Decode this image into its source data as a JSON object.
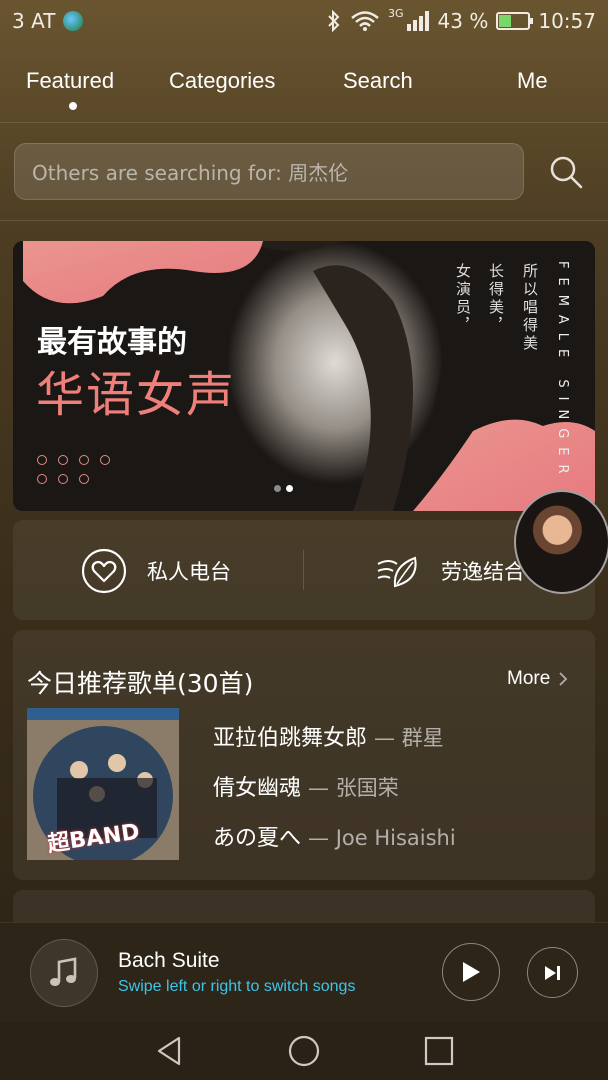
{
  "status_bar": {
    "carrier": "3 AT",
    "network": "3G",
    "battery_percent": "43 %",
    "battery_level": 0.43,
    "time": "10:57"
  },
  "tabs": [
    {
      "label": "Featured",
      "active": true
    },
    {
      "label": "Categories",
      "active": false
    },
    {
      "label": "Search",
      "active": false
    },
    {
      "label": "Me",
      "active": false
    }
  ],
  "search": {
    "placeholder": "Others are searching for: 周杰伦"
  },
  "banner": {
    "line1": "最有故事的",
    "line2": "华语女声",
    "vertical_text_1": "所以唱得美",
    "vertical_text_2": "长得美，",
    "vertical_text_3": "女演员，",
    "vertical_english": "FEMALE SINGER",
    "page_count": 2,
    "active_page": 2
  },
  "quick_actions": [
    {
      "label": "私人电台",
      "icon": "heart-radio-icon"
    },
    {
      "label": "劳逸结合",
      "icon": "leaf-wind-icon"
    }
  ],
  "playlist": {
    "title": "今日推荐歌单(30首)",
    "more_label": "More",
    "album_text": "超BAND",
    "songs": [
      {
        "title": "亚拉伯跳舞女郎",
        "artist": "— 群星"
      },
      {
        "title": "倩女幽魂",
        "artist": "— 张国荣"
      },
      {
        "title": "あの夏へ",
        "artist": "— Joe Hisaishi"
      }
    ]
  },
  "player": {
    "track_title": "Bach Suite",
    "hint": "Swipe left or right to switch songs"
  },
  "colors": {
    "accent_pink": "#ef7f7a",
    "hint_blue": "#3fc3e6",
    "background": "#4c3c22"
  }
}
